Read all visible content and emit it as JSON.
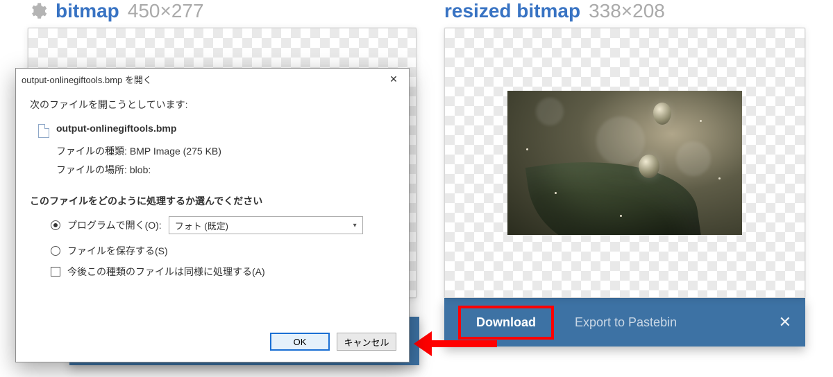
{
  "left_pane": {
    "title": "bitmap",
    "dimensions": "450×277"
  },
  "right_pane": {
    "title": "resized bitmap",
    "dimensions": "338×208",
    "download_label": "Download",
    "export_label": "Export to Pastebin",
    "close_glyph": "✕"
  },
  "dialog": {
    "title": "output-onlinegiftools.bmp を開く",
    "opening_line": "次のファイルを開こうとしています:",
    "filename": "output-onlinegiftools.bmp",
    "filetype_label": "ファイルの種類:",
    "filetype_value": "BMP Image (275 KB)",
    "location_label": "ファイルの場所:",
    "location_value": "blob:",
    "question": "このファイルをどのように処理するか選んでください",
    "open_with_label": "プログラムで開く(O):",
    "open_with_value": "フォト (既定)",
    "save_file_label": "ファイルを保存する(S)",
    "remember_label": "今後この種類のファイルは同様に処理する(A)",
    "ok_label": "OK",
    "cancel_label": "キャンセル"
  }
}
